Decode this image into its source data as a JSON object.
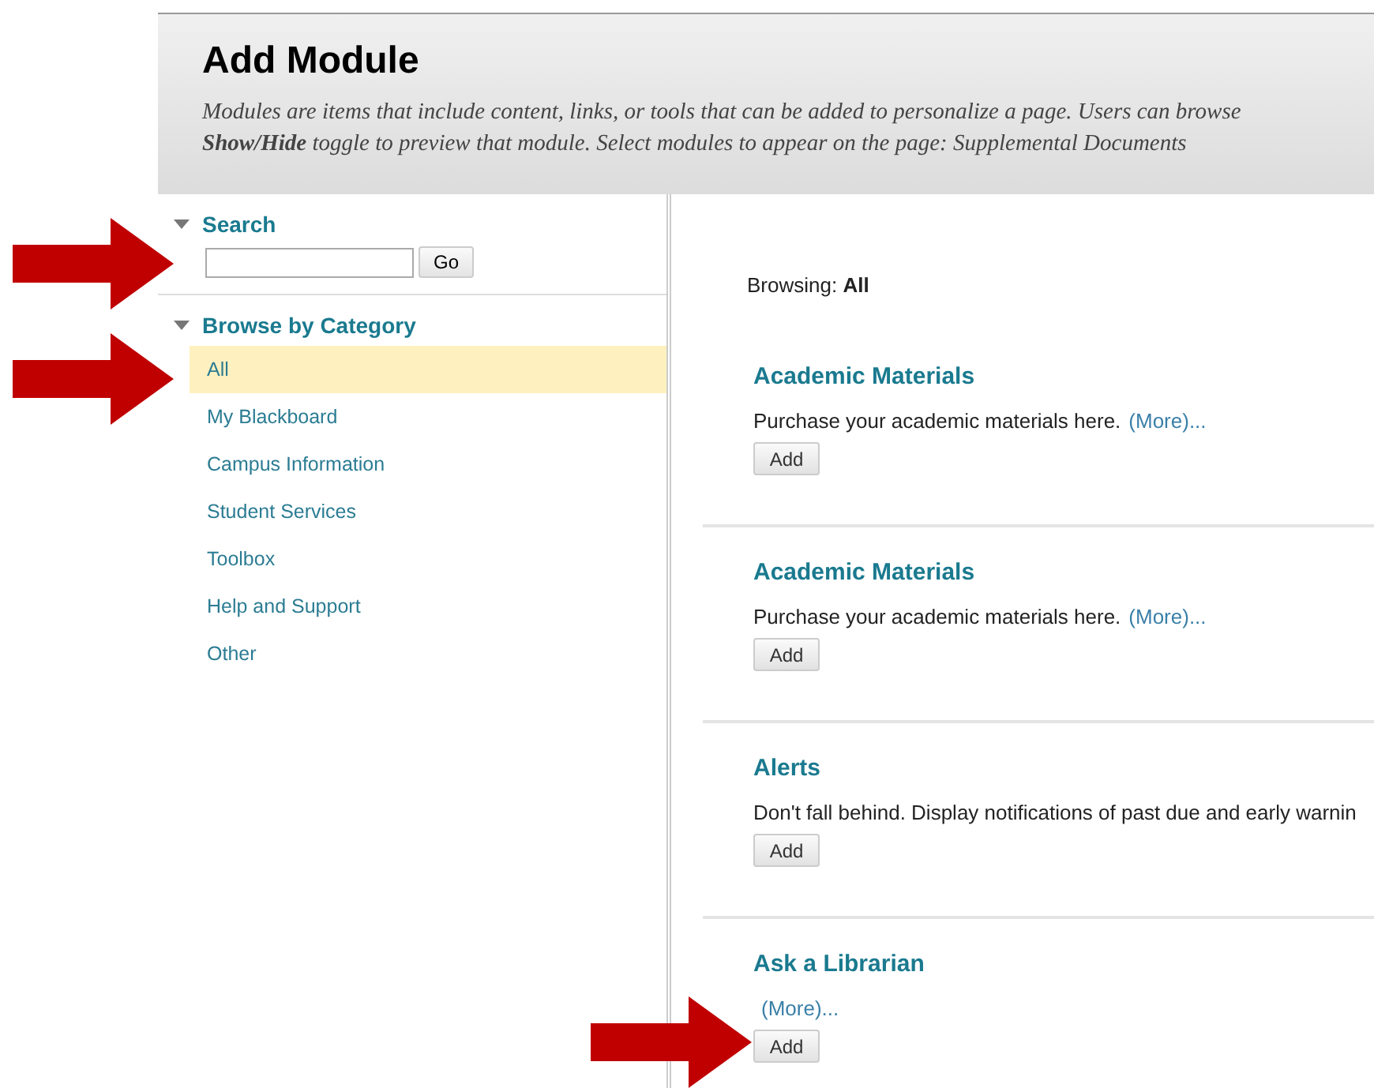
{
  "header": {
    "title": "Add Module",
    "description_lines": [
      "Modules are items that include content, links, or tools that can be added to personalize a page. Users can browse",
      "**Show/Hide** toggle to preview that module. Select modules to appear on the page: Supplemental Documents"
    ]
  },
  "sidebar": {
    "search": {
      "heading": "Search",
      "expanded": true,
      "button": "Go"
    },
    "browse": {
      "heading": "Browse by Category",
      "expanded": true,
      "items": [
        {
          "label": "All",
          "selected": true
        },
        {
          "label": "My Blackboard",
          "selected": false
        },
        {
          "label": "Campus Information",
          "selected": false
        },
        {
          "label": "Student Services",
          "selected": false
        },
        {
          "label": "Toolbox",
          "selected": false
        },
        {
          "label": "Help and Support",
          "selected": false
        },
        {
          "label": "Other",
          "selected": false
        }
      ]
    }
  },
  "content": {
    "browsing_label": "Browsing:",
    "browsing_value": "All",
    "modules": [
      {
        "title": "Academic Materials",
        "description": "Purchase your academic materials here.",
        "more": "(More)...",
        "button": "Add"
      },
      {
        "title": "Academic Materials",
        "description": "Purchase your academic materials here.",
        "more": "(More)...",
        "button": "Add"
      },
      {
        "title": "Alerts",
        "description": "Don't fall behind. Display notifications of past due and early warnin",
        "button": "Add"
      },
      {
        "title": "Ask a Librarian",
        "more": "(More)...",
        "button": "Add"
      }
    ]
  }
}
